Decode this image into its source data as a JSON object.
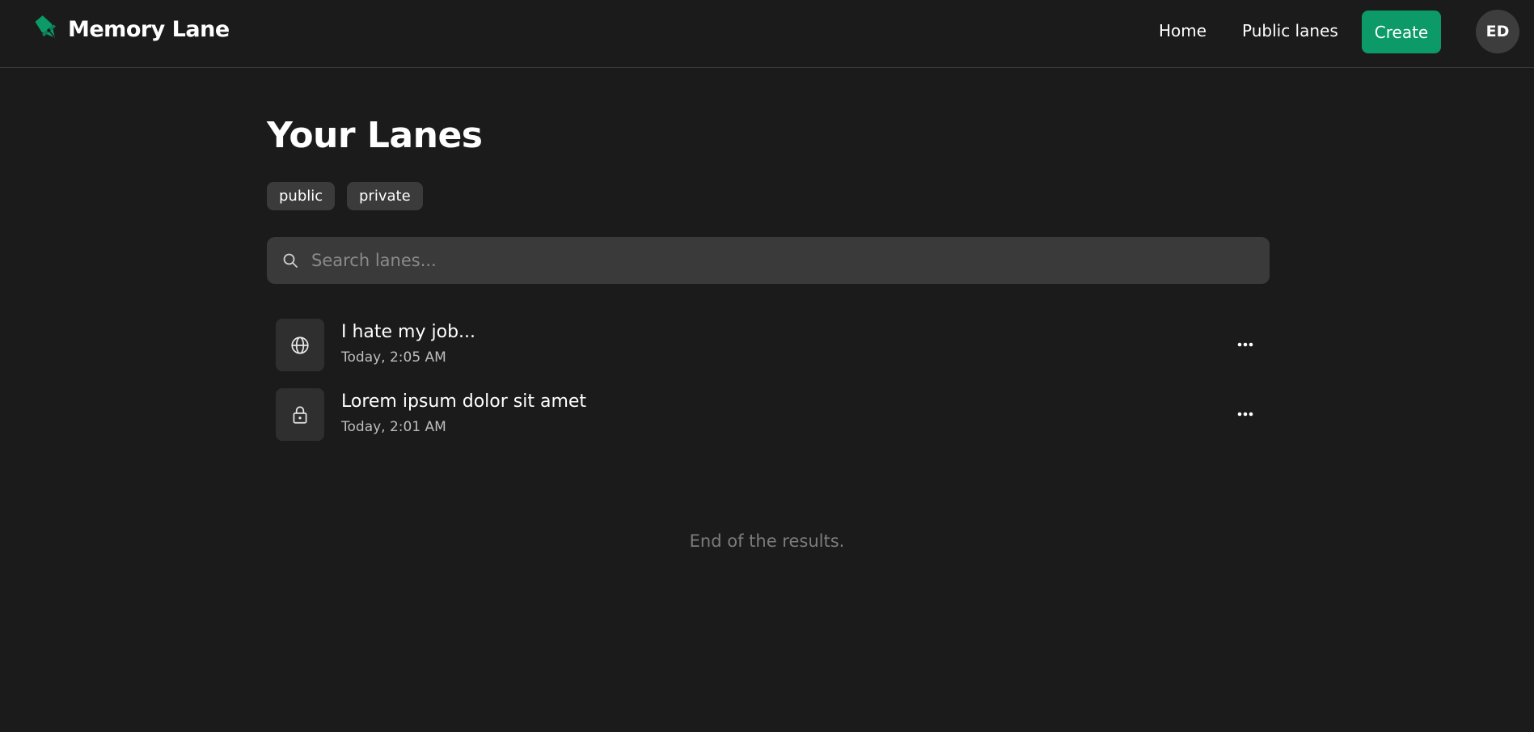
{
  "app": {
    "name": "Memory Lane",
    "accent": "#0b9a68"
  },
  "nav": {
    "home": "Home",
    "public_lanes": "Public lanes",
    "create": "Create",
    "avatar_initials": "ED"
  },
  "page": {
    "title": "Your Lanes",
    "filters": [
      "public",
      "private"
    ]
  },
  "search": {
    "placeholder": "Search lanes...",
    "value": ""
  },
  "lanes": [
    {
      "title": "I hate my job...",
      "time": "Today, 2:05 AM",
      "icon": "globe-icon",
      "visibility": "public"
    },
    {
      "title": "Lorem ipsum dolor sit amet",
      "time": "Today, 2:01 AM",
      "icon": "lock-icon",
      "visibility": "private"
    }
  ],
  "footer": {
    "end_text": "End of the results."
  }
}
